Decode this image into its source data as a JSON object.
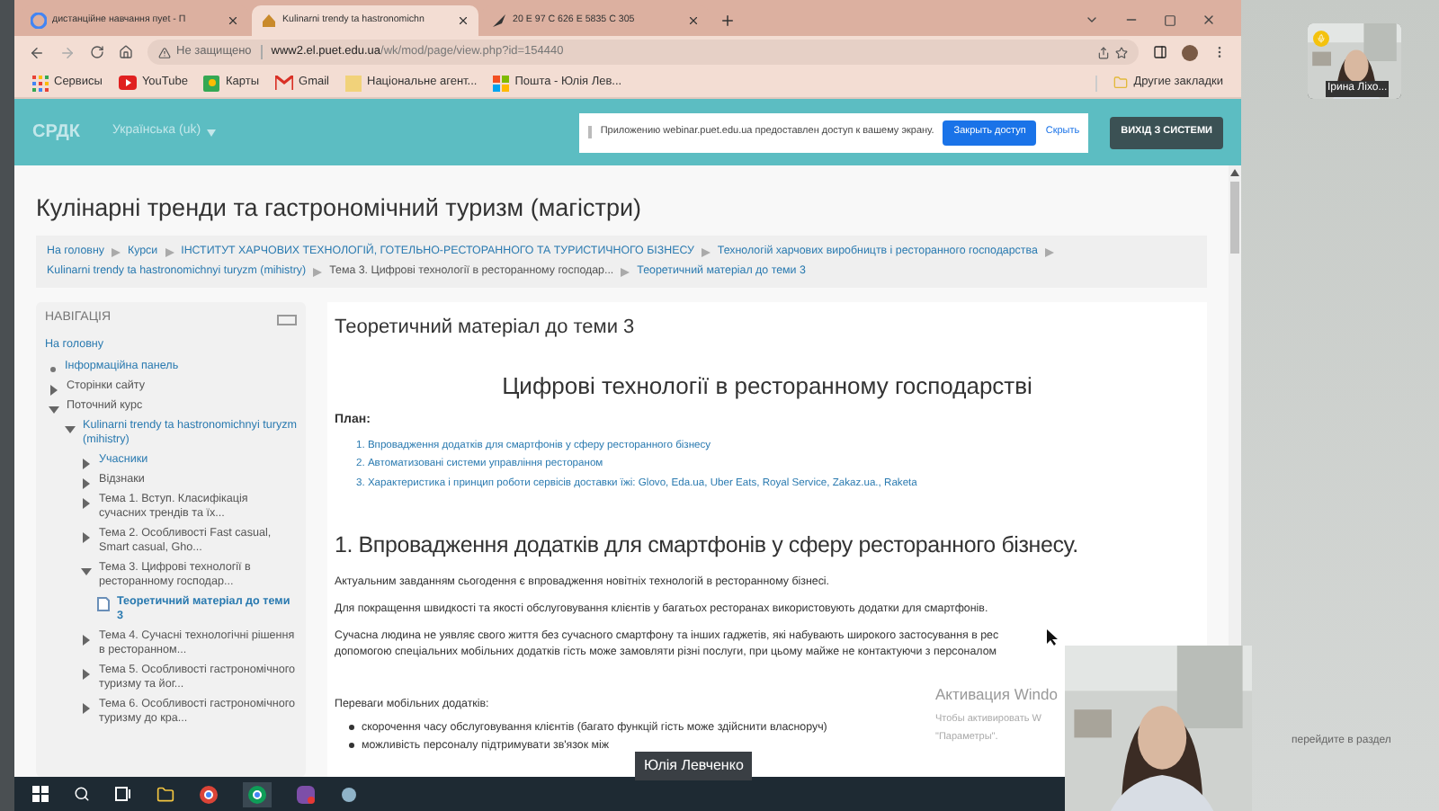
{
  "browser": {
    "tabs": [
      {
        "title": "дистанційне навчання пуеt - П",
        "selected": false
      },
      {
        "title": "Kulinarni trendy ta hastronomichn",
        "selected": true
      },
      {
        "title": "20 E 97 C 626 E 5835 C 305",
        "selected": false
      }
    ],
    "security": "Не защищено",
    "url_host": "www2.el.puet.edu.ua",
    "url_path": "/wk/mod/page/view.php?id=154440",
    "bookmarks": [
      "Сервисы",
      "YouTube",
      "Карты",
      "Gmail",
      "Національне агент...",
      "Пошта - Юлія Лев..."
    ],
    "other_bookmarks": "Другие закладки"
  },
  "site_header": {
    "logo": "СРДК",
    "language": "Українська (uk)",
    "share_notice": "Приложению webinar.puet.edu.ua предоставлен доступ к вашему экрану.",
    "stop_sharing": "Закрыть доступ",
    "hide": "Скрыть",
    "logout": "ВИХІД З СИСТЕМИ"
  },
  "page_title": "Кулінарні тренди та гастрономічний туризм (магістри)",
  "breadcrumb": [
    {
      "label": "На головну",
      "kind": "link"
    },
    {
      "label": "Курси",
      "kind": "link"
    },
    {
      "label": "ІНСТИТУТ ХАРЧОВИХ ТЕХНОЛОГІЙ, ГОТЕЛЬНО-РЕСТОРАННОГО ТА ТУРИСТИЧНОГО БІЗНЕСУ",
      "kind": "link"
    },
    {
      "label": "Технологій харчових виробництв і ресторанного господарства",
      "kind": "link"
    },
    {
      "label": "Kulinarni trendy ta hastronomichnyi turyzm (mihistry)",
      "kind": "link"
    },
    {
      "label": "Тема 3. Цифрові технології в ресторанному господар...",
      "kind": "text"
    },
    {
      "label": "Теоретичний матеріал до теми 3",
      "kind": "link"
    }
  ],
  "navigation": {
    "title": "НАВІГАЦІЯ",
    "home": "На головну",
    "items": [
      {
        "label": "Інформаційна панель",
        "kind": "leaf",
        "link": true
      },
      {
        "label": "Сторінки сайту",
        "kind": "branch",
        "link": false,
        "expanded": false
      },
      {
        "label": "Поточний курс",
        "kind": "branch",
        "link": false,
        "expanded": true,
        "children": [
          {
            "label": "Kulinarni trendy ta hastronomichnyi turyzm (mihistry)",
            "kind": "branch",
            "link": true,
            "expanded": true,
            "children": [
              {
                "label": "Учасники",
                "kind": "branch",
                "link": true,
                "expanded": false
              },
              {
                "label": "Відзнаки",
                "kind": "branch",
                "link": false,
                "expanded": false
              },
              {
                "label": "Тема 1. Вступ. Класифікація сучасних трендів та їх...",
                "kind": "branch",
                "link": false,
                "expanded": false
              },
              {
                "label": "Тема 2. Особливості Fast casual, Smart casual, Gho...",
                "kind": "branch",
                "link": false,
                "expanded": false
              },
              {
                "label": "Тема 3. Цифрові технології в ресторанному господар...",
                "kind": "branch",
                "link": false,
                "expanded": true,
                "children": [
                  {
                    "label": "Теоретичний матеріал до теми 3",
                    "kind": "page",
                    "link": true,
                    "selected": true
                  }
                ]
              },
              {
                "label": "Тема 4. Сучасні технологічні рішення в ресторанном...",
                "kind": "branch",
                "link": false,
                "expanded": false
              },
              {
                "label": "Тема 5. Особливості гастрономічного туризму та йог...",
                "kind": "branch",
                "link": false,
                "expanded": false
              },
              {
                "label": "Тема 6. Особливості гастрономічного туризму до кра...",
                "kind": "branch",
                "link": false,
                "expanded": false
              }
            ]
          }
        ]
      }
    ]
  },
  "content": {
    "heading": "Теоретичний матеріал до теми 3",
    "title": "Цифрові технології в ресторанному господарстві",
    "plan_label": "План:",
    "plan": [
      "1. Впровадження додатків для смартфонів у сферу ресторанного бізнесу",
      "2. Автоматизовані системи управління рестораном",
      "3. Характеристика і принцип роботи сервісів доставки їжі: Glovo, Eda.ua, Uber Eats, Royal Service, Zakaz.ua., Raketa"
    ],
    "section_title": "1. Впровадження додатків для смартфонів у сферу ресторанного бізнесу.",
    "paragraphs": [
      [
        "Актуальним завданням сьогодення є впровадження новітніх технологій в ресторанному бізнесі."
      ],
      [
        "Для покращення швидкості та якості обслуговування клієнтів у багатьох ресторанах використовують додатки для смартфонів."
      ],
      [
        "Сучасна людина не уявляє свого життя без сучасного смартфону та інших гаджетів, які набувають широкого застосування в рес",
        "допомогою спеціальних мобільних додатків гість може замовляти різні послуги, при цьому майже не контактуючи з персоналом"
      ]
    ],
    "advantages_label": "Переваги мобільних додатків:",
    "advantages": [
      "скорочення часу обслуговування клієнтів (багато функцій гість може здійснити власноруч)",
      "можливість персоналу підтримувати зв'язок між"
    ]
  },
  "os_notice": [
    "Активация Windo",
    "Чтобы активировать W",
    "\"Параметры\"."
  ],
  "os_notice_side": "перейдите в раздел",
  "call": {
    "participant": "Ірина Ліхо...",
    "speaker": "Юлія Левченко"
  }
}
